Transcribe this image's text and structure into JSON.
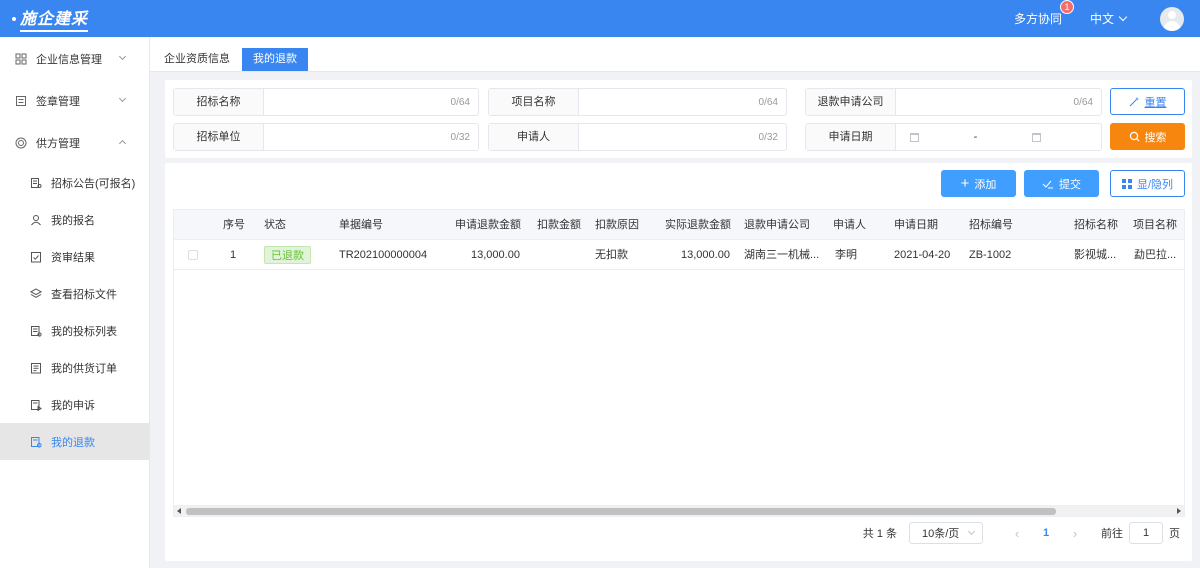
{
  "header": {
    "logo": "施企建采",
    "collab_label": "多方协同",
    "collab_badge": "1",
    "language": "中文",
    "brand_color": "#3a86f0"
  },
  "sidebar": {
    "groups": [
      {
        "label": "企业信息管理",
        "icon": "grid-icon",
        "expanded": false
      },
      {
        "label": "签章管理",
        "icon": "seal-icon",
        "expanded": false
      },
      {
        "label": "供方管理",
        "icon": "target-icon",
        "expanded": true
      }
    ],
    "items": [
      {
        "label": "招标公告(可报名)",
        "icon": "notice-icon"
      },
      {
        "label": "我的报名",
        "icon": "user-icon"
      },
      {
        "label": "资审结果",
        "icon": "clipboard-check-icon"
      },
      {
        "label": "查看招标文件",
        "icon": "layers-icon"
      },
      {
        "label": "我的投标列表",
        "icon": "document-list-icon"
      },
      {
        "label": "我的供货订单",
        "icon": "order-icon"
      },
      {
        "label": "我的申诉",
        "icon": "appeal-icon"
      },
      {
        "label": "我的退款",
        "icon": "refund-icon",
        "active": true
      }
    ]
  },
  "tabs": [
    {
      "label": "企业资质信息",
      "active": false
    },
    {
      "label": "我的退款",
      "active": true
    }
  ],
  "search": {
    "fields": [
      {
        "label": "招标名称",
        "count": "0/64"
      },
      {
        "label": "项目名称",
        "count": "0/64"
      },
      {
        "label": "退款申请公司",
        "count": "0/64"
      },
      {
        "label": "招标单位",
        "count": "0/32"
      },
      {
        "label": "申请人",
        "count": "0/32"
      },
      {
        "label": "申请日期",
        "date_separator": "-"
      }
    ],
    "reset_label": "重置",
    "search_label": "搜索",
    "search_color": "#f7860f"
  },
  "toolbar": {
    "add_label": "添加",
    "submit_label": "提交",
    "columns_label": "显/隐列"
  },
  "table": {
    "headers": [
      "序号",
      "状态",
      "单据编号",
      "申请退款金额",
      "扣款金额",
      "扣款原因",
      "实际退款金额",
      "退款申请公司",
      "申请人",
      "申请日期",
      "招标编号",
      "招标名称",
      "项目名称"
    ],
    "rows": [
      {
        "index": "1",
        "status": "已退款",
        "doc_no": "TR202100000004",
        "apply_amount": "13,000.00",
        "deduct_amount": "",
        "deduct_reason": "无扣款",
        "actual_amount": "13,000.00",
        "company": "湖南三一机械...",
        "applicant": "李明",
        "date": "2021-04-20",
        "bid_no": "ZB-1002",
        "bid_name": "影视城...",
        "project_name": "勐巴拉..."
      }
    ]
  },
  "pagination": {
    "total": "共 1 条",
    "page_size": "10条/页",
    "prev": "‹",
    "current": "1",
    "next": "›",
    "goto_label": "前往",
    "goto_value": "1",
    "page_suffix": "页"
  }
}
